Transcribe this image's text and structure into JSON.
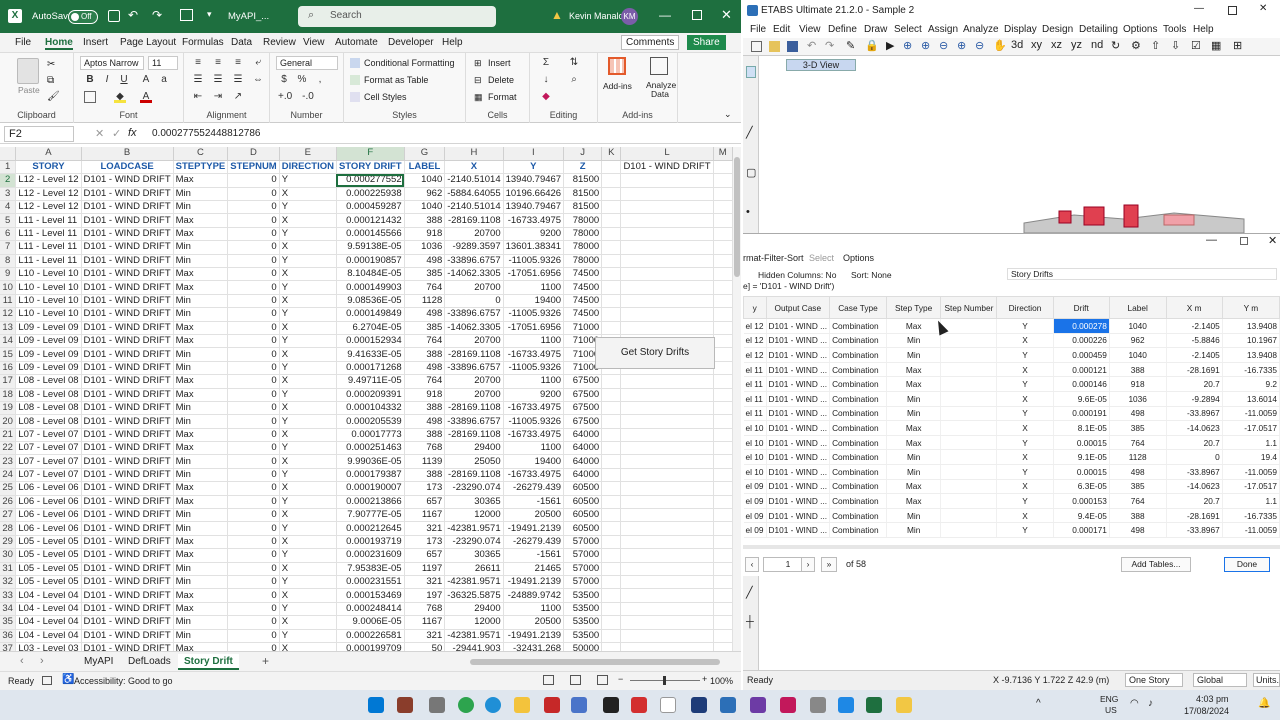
{
  "excel": {
    "autosave_label": "AutoSave",
    "autosave_state": "Off",
    "file_name": "MyAPI_...",
    "search_placeholder": "Search",
    "user_name": "Kevin Manalo",
    "user_initials": "KM",
    "tabs": [
      "File",
      "Home",
      "Insert",
      "Page Layout",
      "Formulas",
      "Data",
      "Review",
      "View",
      "Automate",
      "Developer",
      "Help"
    ],
    "comments_label": "Comments",
    "share_label": "Share",
    "ribbon": {
      "clipboard": "Clipboard",
      "paste": "Paste",
      "font": "Font",
      "font_name": "Aptos Narrow",
      "font_size": "11",
      "alignment": "Alignment",
      "number": "Number",
      "number_format": "General",
      "styles": "Styles",
      "conditional_formatting": "Conditional Formatting",
      "format_as_table": "Format as Table",
      "cell_styles": "Cell Styles",
      "cells": "Cells",
      "insert": "Insert",
      "delete": "Delete",
      "format": "Format",
      "editing": "Editing",
      "addins": "Add-ins",
      "addins_btn": "Add-ins",
      "analyze": "Analyze Data",
      "addins_group": "Add-ins"
    },
    "name_box": "F2",
    "formula": "0.000277552448812786",
    "col_letters": [
      "A",
      "B",
      "C",
      "D",
      "E",
      "F",
      "G",
      "H",
      "I",
      "J",
      "K",
      "L",
      "M"
    ],
    "headers": [
      "STORY",
      "LOADCASE",
      "STEPTYPE",
      "STEPNUM",
      "DIRECTION",
      "STORY DRIFT",
      "LABEL",
      "X",
      "Y",
      "Z"
    ],
    "l1_text": "D101 - WIND DRIFT",
    "macro_button": "Get Story Drifts",
    "rows": [
      [
        "L12 - Level 12",
        "D101 - WIND DRIFT",
        "Max",
        "0",
        "Y",
        "0.000277552",
        "1040",
        "-2140.51014",
        "13940.79467",
        "81500"
      ],
      [
        "L12 - Level 12",
        "D101 - WIND DRIFT",
        "Min",
        "0",
        "X",
        "0.000225938",
        "962",
        "-5884.64055",
        "10196.66426",
        "81500"
      ],
      [
        "L12 - Level 12",
        "D101 - WIND DRIFT",
        "Min",
        "0",
        "Y",
        "0.000459287",
        "1040",
        "-2140.51014",
        "13940.79467",
        "81500"
      ],
      [
        "L11 - Level 11",
        "D101 - WIND DRIFT",
        "Max",
        "0",
        "X",
        "0.000121432",
        "388",
        "-28169.1108",
        "-16733.4975",
        "78000"
      ],
      [
        "L11 - Level 11",
        "D101 - WIND DRIFT",
        "Max",
        "0",
        "Y",
        "0.000145566",
        "918",
        "20700",
        "9200",
        "78000"
      ],
      [
        "L11 - Level 11",
        "D101 - WIND DRIFT",
        "Min",
        "0",
        "X",
        "9.59138E-05",
        "1036",
        "-9289.3597",
        "13601.38341",
        "78000"
      ],
      [
        "L11 - Level 11",
        "D101 - WIND DRIFT",
        "Min",
        "0",
        "Y",
        "0.000190857",
        "498",
        "-33896.6757",
        "-11005.9326",
        "78000"
      ],
      [
        "L10 - Level 10",
        "D101 - WIND DRIFT",
        "Max",
        "0",
        "X",
        "8.10484E-05",
        "385",
        "-14062.3305",
        "-17051.6956",
        "74500"
      ],
      [
        "L10 - Level 10",
        "D101 - WIND DRIFT",
        "Max",
        "0",
        "Y",
        "0.000149903",
        "764",
        "20700",
        "1100",
        "74500"
      ],
      [
        "L10 - Level 10",
        "D101 - WIND DRIFT",
        "Min",
        "0",
        "X",
        "9.08536E-05",
        "1128",
        "0",
        "19400",
        "74500"
      ],
      [
        "L10 - Level 10",
        "D101 - WIND DRIFT",
        "Min",
        "0",
        "Y",
        "0.000149849",
        "498",
        "-33896.6757",
        "-11005.9326",
        "74500"
      ],
      [
        "L09 - Level 09",
        "D101 - WIND DRIFT",
        "Max",
        "0",
        "X",
        "6.2704E-05",
        "385",
        "-14062.3305",
        "-17051.6956",
        "71000"
      ],
      [
        "L09 - Level 09",
        "D101 - WIND DRIFT",
        "Max",
        "0",
        "Y",
        "0.000152934",
        "764",
        "20700",
        "1100",
        "71000"
      ],
      [
        "L09 - Level 09",
        "D101 - WIND DRIFT",
        "Min",
        "0",
        "X",
        "9.41633E-05",
        "388",
        "-28169.1108",
        "-16733.4975",
        "71000"
      ],
      [
        "L09 - Level 09",
        "D101 - WIND DRIFT",
        "Min",
        "0",
        "Y",
        "0.000171268",
        "498",
        "-33896.6757",
        "-11005.9326",
        "71000"
      ],
      [
        "L08 - Level 08",
        "D101 - WIND DRIFT",
        "Max",
        "0",
        "X",
        "9.49711E-05",
        "764",
        "20700",
        "1100",
        "67500"
      ],
      [
        "L08 - Level 08",
        "D101 - WIND DRIFT",
        "Max",
        "0",
        "Y",
        "0.000209391",
        "918",
        "20700",
        "9200",
        "67500"
      ],
      [
        "L08 - Level 08",
        "D101 - WIND DRIFT",
        "Min",
        "0",
        "X",
        "0.000104332",
        "388",
        "-28169.1108",
        "-16733.4975",
        "67500"
      ],
      [
        "L08 - Level 08",
        "D101 - WIND DRIFT",
        "Min",
        "0",
        "Y",
        "0.000205539",
        "498",
        "-33896.6757",
        "-11005.9326",
        "67500"
      ],
      [
        "L07 - Level 07",
        "D101 - WIND DRIFT",
        "Max",
        "0",
        "X",
        "0.00017773",
        "388",
        "-28169.1108",
        "-16733.4975",
        "64000"
      ],
      [
        "L07 - Level 07",
        "D101 - WIND DRIFT",
        "Max",
        "0",
        "Y",
        "0.000251463",
        "768",
        "29400",
        "1100",
        "64000"
      ],
      [
        "L07 - Level 07",
        "D101 - WIND DRIFT",
        "Min",
        "0",
        "X",
        "9.99036E-05",
        "1139",
        "25050",
        "19400",
        "64000"
      ],
      [
        "L07 - Level 07",
        "D101 - WIND DRIFT",
        "Min",
        "0",
        "Y",
        "0.000179387",
        "388",
        "-28169.1108",
        "-16733.4975",
        "64000"
      ],
      [
        "L06 - Level 06",
        "D101 - WIND DRIFT",
        "Max",
        "0",
        "X",
        "0.000190007",
        "173",
        "-23290.074",
        "-26279.439",
        "60500"
      ],
      [
        "L06 - Level 06",
        "D101 - WIND DRIFT",
        "Max",
        "0",
        "Y",
        "0.000213866",
        "657",
        "30365",
        "-1561",
        "60500"
      ],
      [
        "L06 - Level 06",
        "D101 - WIND DRIFT",
        "Min",
        "0",
        "X",
        "7.90777E-05",
        "1167",
        "12000",
        "20500",
        "60500"
      ],
      [
        "L06 - Level 06",
        "D101 - WIND DRIFT",
        "Min",
        "0",
        "Y",
        "0.000212645",
        "321",
        "-42381.9571",
        "-19491.2139",
        "60500"
      ],
      [
        "L05 - Level 05",
        "D101 - WIND DRIFT",
        "Max",
        "0",
        "X",
        "0.000193719",
        "173",
        "-23290.074",
        "-26279.439",
        "57000"
      ],
      [
        "L05 - Level 05",
        "D101 - WIND DRIFT",
        "Max",
        "0",
        "Y",
        "0.000231609",
        "657",
        "30365",
        "-1561",
        "57000"
      ],
      [
        "L05 - Level 05",
        "D101 - WIND DRIFT",
        "Min",
        "0",
        "X",
        "7.95383E-05",
        "1197",
        "26611",
        "21465",
        "57000"
      ],
      [
        "L05 - Level 05",
        "D101 - WIND DRIFT",
        "Min",
        "0",
        "Y",
        "0.000231551",
        "321",
        "-42381.9571",
        "-19491.2139",
        "57000"
      ],
      [
        "L04 - Level 04",
        "D101 - WIND DRIFT",
        "Max",
        "0",
        "X",
        "0.000153469",
        "197",
        "-36325.5875",
        "-24889.9742",
        "53500"
      ],
      [
        "L04 - Level 04",
        "D101 - WIND DRIFT",
        "Max",
        "0",
        "Y",
        "0.000248414",
        "768",
        "29400",
        "1100",
        "53500"
      ],
      [
        "L04 - Level 04",
        "D101 - WIND DRIFT",
        "Min",
        "0",
        "X",
        "9.0006E-05",
        "1167",
        "12000",
        "20500",
        "53500"
      ],
      [
        "L04 - Level 04",
        "D101 - WIND DRIFT",
        "Min",
        "0",
        "Y",
        "0.000226581",
        "321",
        "-42381.9571",
        "-19491.2139",
        "53500"
      ],
      [
        "L03 - Level 03",
        "D101 - WIND DRIFT",
        "Max",
        "0",
        "X",
        "0.000199709",
        "50",
        "-29441.903",
        "-32431.268",
        "50000"
      ]
    ],
    "sheets": [
      "MyAPI",
      "DefLoads",
      "Story Drift"
    ],
    "active_sheet": "Story Drift",
    "status_ready": "Ready",
    "accessibility": "Accessibility: Good to go",
    "zoom": "100%"
  },
  "etabs": {
    "title": "ETABS Ultimate 21.2.0 - Sample 2",
    "menu": [
      "File",
      "Edit",
      "View",
      "Define",
      "Draw",
      "Select",
      "Assign",
      "Analyze",
      "Display",
      "Design",
      "Detailing",
      "Options",
      "Tools",
      "Help"
    ],
    "view_tab": "3-D View",
    "dlg_menu": [
      "rmat-Filter-Sort",
      "Select",
      "Options"
    ],
    "hidden_columns": "Hidden Columns:  No",
    "sort": "Sort:  None",
    "table_name": "Story Drifts",
    "filter": "e] = 'D101 - WIND Drift')",
    "columns": [
      "y",
      "Output Case",
      "Case Type",
      "Step Type",
      "Step Number",
      "Direction",
      "Drift",
      "Label",
      "X m",
      "Y m"
    ],
    "rows": [
      [
        "el 12",
        "D101 - WIND ...",
        "Combination",
        "Max",
        "",
        "Y",
        "0.000278",
        "1040",
        "-2.1405",
        "13.9408"
      ],
      [
        "el 12",
        "D101 - WIND ...",
        "Combination",
        "Min",
        "",
        "X",
        "0.000226",
        "962",
        "-5.8846",
        "10.1967"
      ],
      [
        "el 12",
        "D101 - WIND ...",
        "Combination",
        "Min",
        "",
        "Y",
        "0.000459",
        "1040",
        "-2.1405",
        "13.9408"
      ],
      [
        "el 11",
        "D101 - WIND ...",
        "Combination",
        "Max",
        "",
        "X",
        "0.000121",
        "388",
        "-28.1691",
        "-16.7335"
      ],
      [
        "el 11",
        "D101 - WIND ...",
        "Combination",
        "Max",
        "",
        "Y",
        "0.000146",
        "918",
        "20.7",
        "9.2"
      ],
      [
        "el 11",
        "D101 - WIND ...",
        "Combination",
        "Min",
        "",
        "X",
        "9.6E-05",
        "1036",
        "-9.2894",
        "13.6014"
      ],
      [
        "el 11",
        "D101 - WIND ...",
        "Combination",
        "Min",
        "",
        "Y",
        "0.000191",
        "498",
        "-33.8967",
        "-11.0059"
      ],
      [
        "el 10",
        "D101 - WIND ...",
        "Combination",
        "Max",
        "",
        "X",
        "8.1E-05",
        "385",
        "-14.0623",
        "-17.0517"
      ],
      [
        "el 10",
        "D101 - WIND ...",
        "Combination",
        "Max",
        "",
        "Y",
        "0.00015",
        "764",
        "20.7",
        "1.1"
      ],
      [
        "el 10",
        "D101 - WIND ...",
        "Combination",
        "Min",
        "",
        "X",
        "9.1E-05",
        "1128",
        "0",
        "19.4"
      ],
      [
        "el 10",
        "D101 - WIND ...",
        "Combination",
        "Min",
        "",
        "Y",
        "0.00015",
        "498",
        "-33.8967",
        "-11.0059"
      ],
      [
        "el 09",
        "D101 - WIND ...",
        "Combination",
        "Max",
        "",
        "X",
        "6.3E-05",
        "385",
        "-14.0623",
        "-17.0517"
      ],
      [
        "el 09",
        "D101 - WIND ...",
        "Combination",
        "Max",
        "",
        "Y",
        "0.000153",
        "764",
        "20.7",
        "1.1"
      ],
      [
        "el 09",
        "D101 - WIND ...",
        "Combination",
        "Min",
        "",
        "X",
        "9.4E-05",
        "388",
        "-28.1691",
        "-16.7335"
      ],
      [
        "el 09",
        "D101 - WIND ...",
        "Combination",
        "Min",
        "",
        "Y",
        "0.000171",
        "498",
        "-33.8967",
        "-11.0059"
      ]
    ],
    "page": "1",
    "of_pages": "of 58",
    "add_tables": "Add Tables...",
    "done": "Done",
    "status_ready": "Ready",
    "coords": "X -9.7136  Y 1.722  Z 42.9 (m)",
    "story_select": "One Story",
    "coord_select": "Global",
    "units": "Units..."
  },
  "taskbar": {
    "lang": "ENG",
    "region": "US",
    "time": "4:03 pm",
    "date": "17/08/2024"
  }
}
